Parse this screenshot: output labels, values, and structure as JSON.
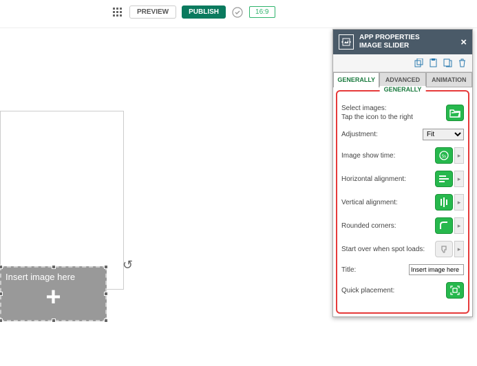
{
  "toolbar": {
    "preview_label": "PREVIEW",
    "publish_label": "PUBLISH",
    "ratio_label": "16:9"
  },
  "placeholder": {
    "text": "Insert image here"
  },
  "panel": {
    "title_line1": "APP PROPERTIES",
    "title_line2": "IMAGE SLIDER",
    "tabs": {
      "generally": "GENERALLY",
      "advanced": "ADVANCED",
      "animation": "ANIMATION"
    },
    "section_label": "GENERALLY",
    "rows": {
      "select_images_label": "Select images:",
      "select_images_hint": "Tap the icon to the right",
      "adjustment_label": "Adjustment:",
      "adjustment_value": "Fit",
      "image_show_time_label": "Image show time:",
      "image_show_time_value": "5s",
      "horizontal_alignment_label": "Horizontal alignment:",
      "vertical_alignment_label": "Vertical alignment:",
      "rounded_corners_label": "Rounded corners:",
      "start_over_label": "Start over when spot loads:",
      "title_label": "Title:",
      "title_value": "Insert image here",
      "quick_placement_label": "Quick placement:"
    }
  }
}
